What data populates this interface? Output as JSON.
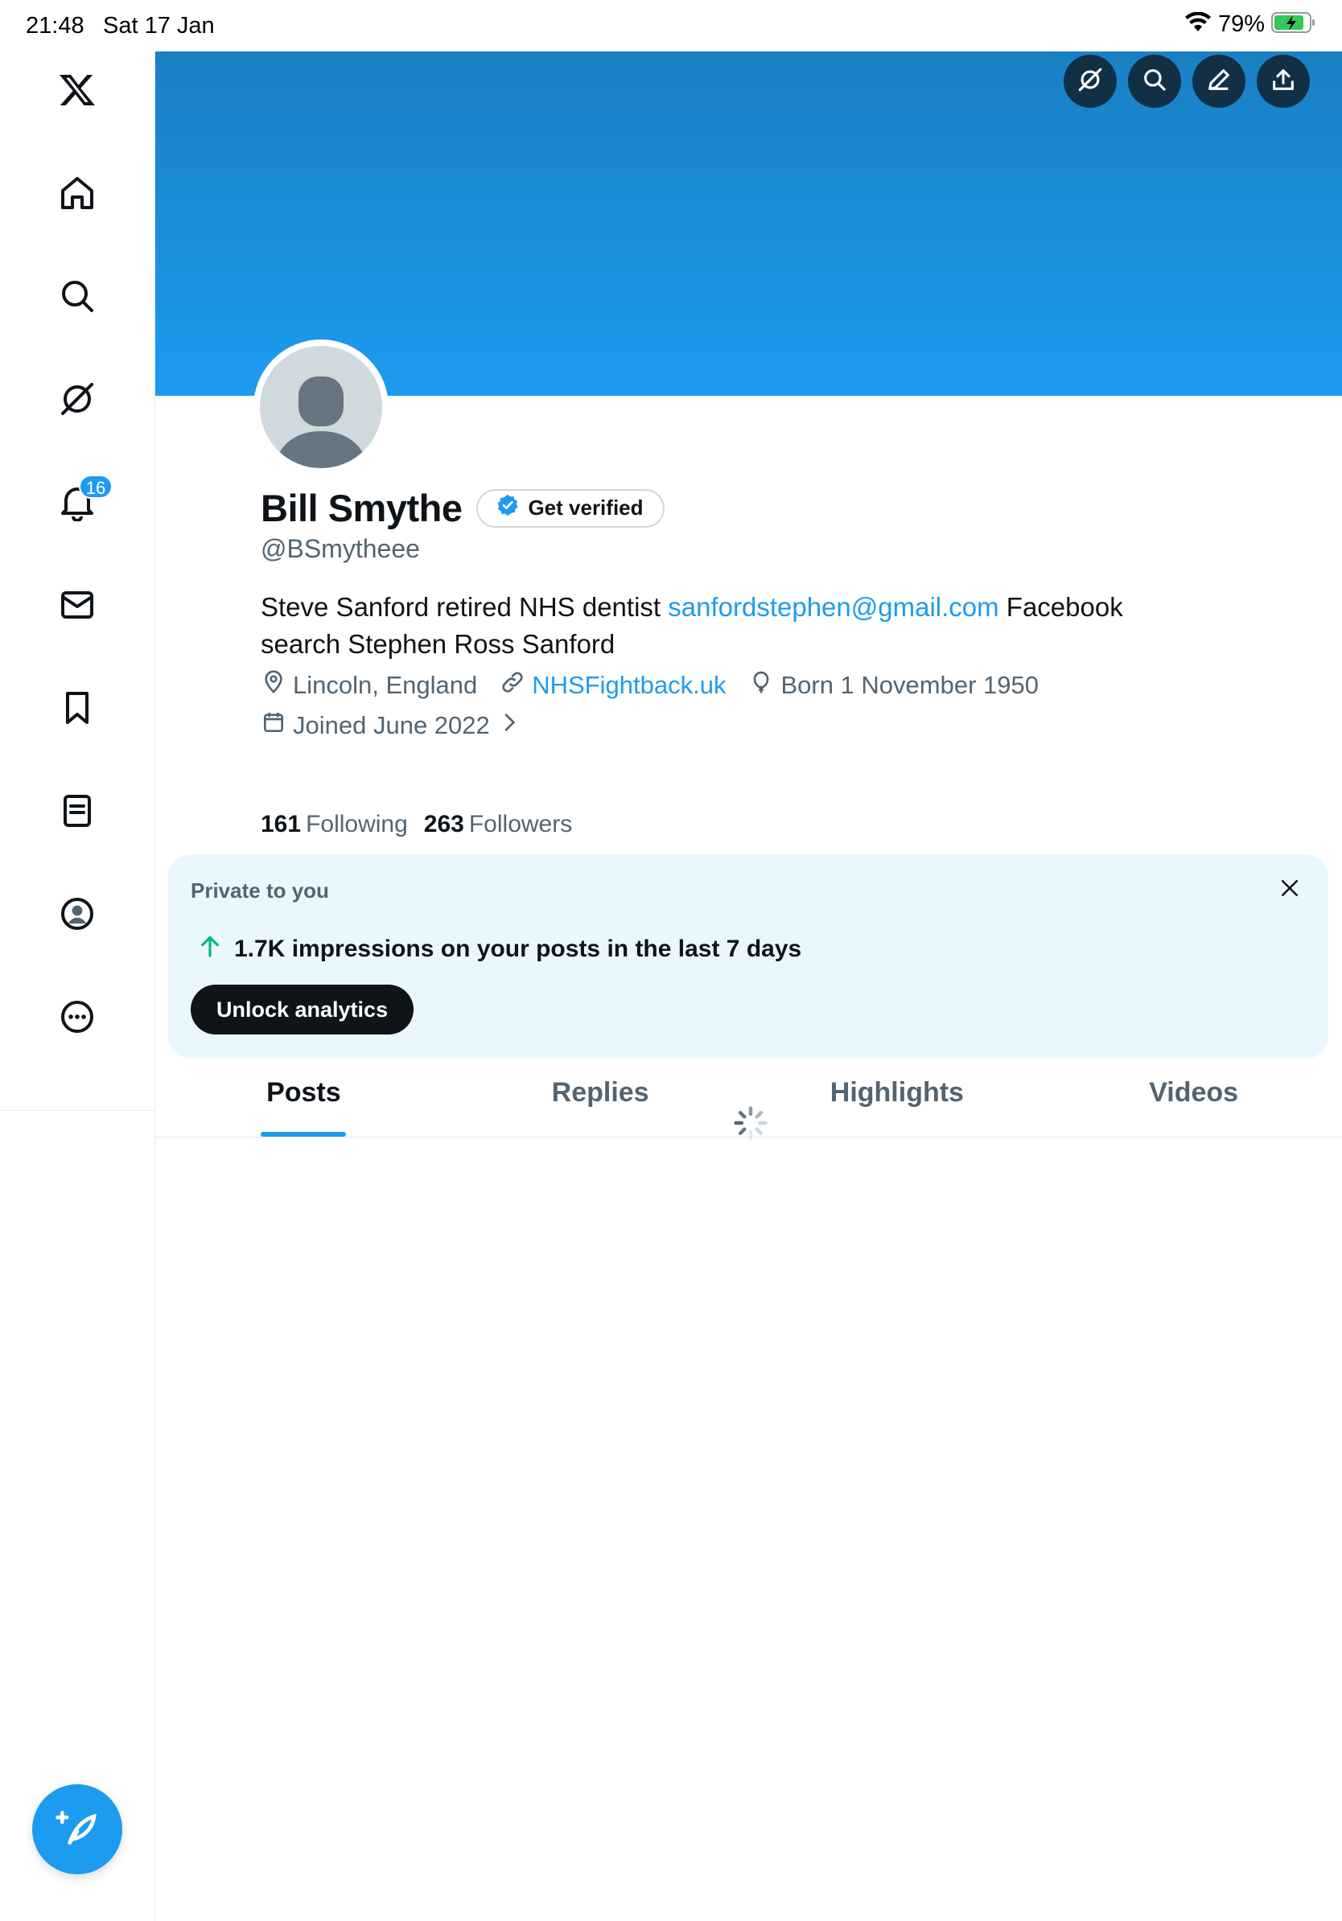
{
  "status_bar": {
    "time": "21:48",
    "date": "Sat 17 Jan",
    "battery": "79%"
  },
  "sidebar": {
    "items": [
      {
        "name": "x-logo-icon"
      },
      {
        "name": "home-icon"
      },
      {
        "name": "search-icon"
      },
      {
        "name": "grok-icon"
      },
      {
        "name": "notifications-icon",
        "badge": "16"
      },
      {
        "name": "messages-icon"
      },
      {
        "name": "bookmarks-icon"
      },
      {
        "name": "lists-icon"
      },
      {
        "name": "profile-icon"
      },
      {
        "name": "more-icon"
      }
    ],
    "compose_icon": "compose-icon"
  },
  "banner": {
    "actions": [
      "grok-icon",
      "search-icon",
      "edit-icon",
      "share-icon"
    ]
  },
  "profile": {
    "display_name": "Bill Smythe",
    "get_verified_label": "Get verified",
    "handle": "@BSmytheee",
    "bio_text_1": "Steve Sanford retired NHS dentist ",
    "bio_link": "sanfordstephen@gmail.com",
    "bio_text_2": " Facebook search Stephen Ross Sanford",
    "location": "Lincoln, England",
    "website": "NHSFightback.uk",
    "birthday": "Born 1 November 1950",
    "joined": "Joined June 2022",
    "following_count": "161",
    "following_label": "Following",
    "followers_count": "263",
    "followers_label": "Followers"
  },
  "analytics": {
    "label": "Private to you",
    "stat": "1.7K impressions on your posts in the last 7 days",
    "button_label": "Unlock analytics"
  },
  "tabs": [
    {
      "label": "Posts",
      "active": true
    },
    {
      "label": "Replies",
      "active": false
    },
    {
      "label": "Highlights",
      "active": false
    },
    {
      "label": "Videos",
      "active": false
    }
  ],
  "colors": {
    "accent": "#1d9bf0",
    "text": "#0f1419",
    "muted": "#536471",
    "analytics_bg": "#eaf7fe",
    "positive": "#00ba7c"
  }
}
